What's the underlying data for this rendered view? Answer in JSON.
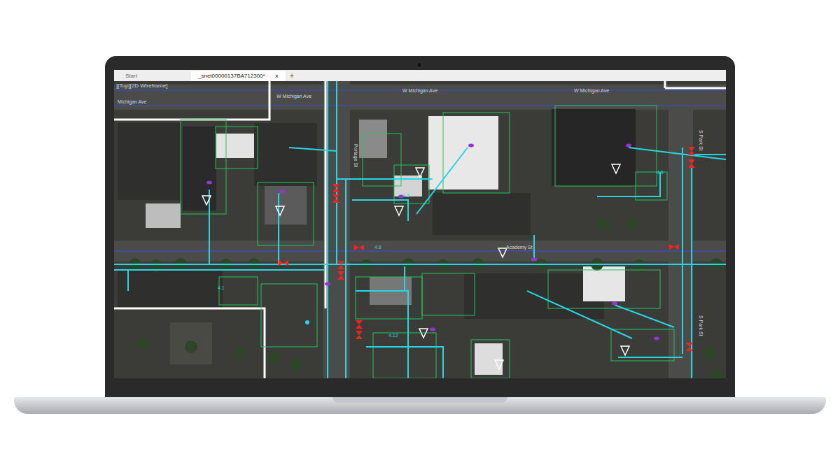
{
  "tabs": [
    {
      "label": "Start",
      "selected": false
    },
    {
      "label": "_snet00000137BA712300*",
      "selected": true
    }
  ],
  "tab_close": "×",
  "new_tab": "+",
  "viewport_label": "][Top][2D Wireframe]",
  "map": {
    "street_labels": [
      "W Michigan Ave",
      "W Michigan Ave",
      "W Michigan Ave",
      "Michigan Ave",
      "Academy St",
      "S Park St",
      "S Park St",
      "Portage St"
    ],
    "pipe_labels": [
      "4.5",
      "4.8",
      "4.12",
      "4.1",
      "4.3"
    ]
  }
}
